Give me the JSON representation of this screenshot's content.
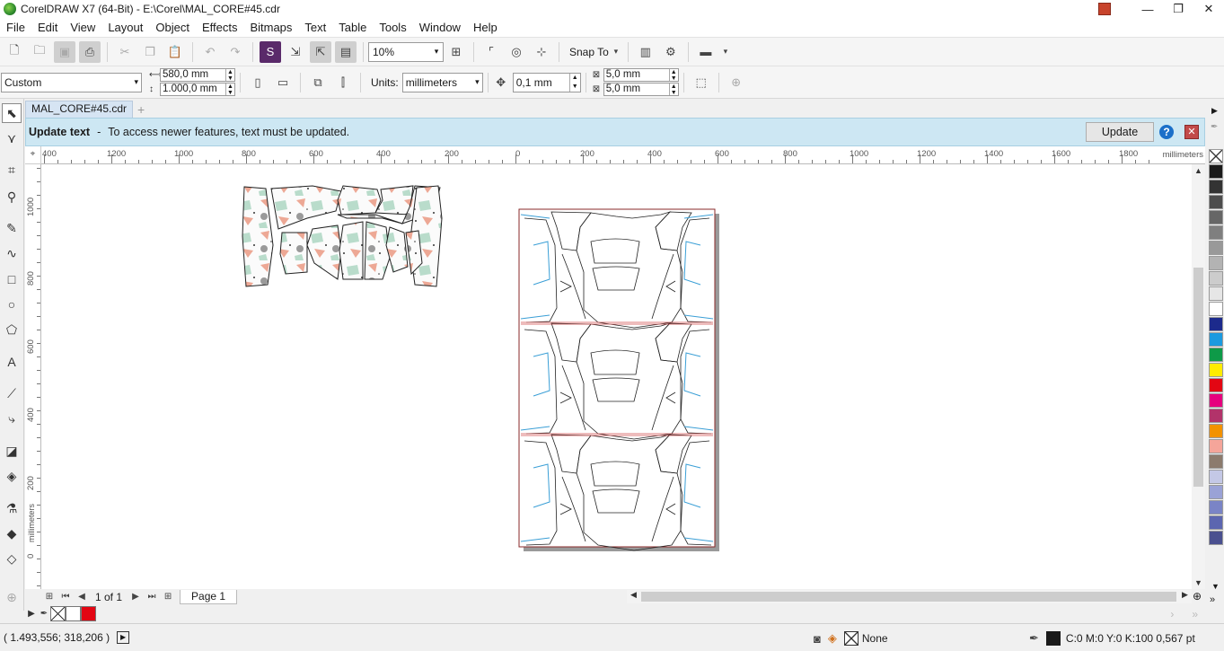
{
  "titlebar": {
    "title": "CorelDRAW X7 (64-Bit) - E:\\Corel\\MAL_CORE#45.cdr",
    "min": "—",
    "max": "❐",
    "close": "✕"
  },
  "menu": [
    "File",
    "Edit",
    "View",
    "Layout",
    "Object",
    "Effects",
    "Bitmaps",
    "Text",
    "Table",
    "Tools",
    "Window",
    "Help"
  ],
  "toolbar": {
    "zoom": "10%",
    "snap_to": "Snap To"
  },
  "propbar": {
    "preset": "Custom",
    "width": "580,0 mm",
    "height": "1.000,0 mm",
    "units_label": "Units:",
    "units": "millimeters",
    "nudge": "0,1 mm",
    "dup_x": "5,0 mm",
    "dup_y": "5,0 mm"
  },
  "doc_tab": {
    "name": "MAL_CORE#45.cdr",
    "add": "+"
  },
  "banner": {
    "title": "Update text",
    "dash": "-",
    "message": "To access newer features, text must be updated.",
    "update_button": "Update",
    "help": "?",
    "close": "✕"
  },
  "hruler": {
    "unit": "millimeters",
    "labels": [
      "400",
      "1200",
      "1000",
      "800",
      "600",
      "400",
      "200",
      "0",
      "200",
      "400",
      "600",
      "800",
      "1000",
      "1200",
      "1400",
      "1600",
      "1800"
    ]
  },
  "vruler": {
    "unit": "millimeters",
    "labels": [
      "1000",
      "800",
      "600",
      "400",
      "200",
      "0"
    ]
  },
  "pagenav": {
    "page_count": "1 of 1",
    "page_tab": "Page 1"
  },
  "status": {
    "coords": "( 1.493,556; 318,206 )",
    "fill": "None",
    "outline": "C:0 M:0 Y:0 K:100  0,567 pt"
  },
  "colors": {
    "accent": "#cde7f3",
    "cut_line": "#d14b4b",
    "seam_blue": "#3a9fd6",
    "pattern_pink": "#eda895",
    "pattern_mint": "#b9dccb",
    "pattern_gray": "#9a9a9a"
  },
  "palette": [
    "#ffffff",
    "#1a1a1a",
    "#333333",
    "#4d4d4d",
    "#666666",
    "#7f7f7f",
    "#999999",
    "#b3b3b3",
    "#cccccc",
    "#e6e6e6",
    "#ffffff",
    "#1c2a8c",
    "#1b9ae0",
    "#0e9a48",
    "#ffec00",
    "#e30613",
    "#e6007e",
    "#b2336a",
    "#f39200",
    "#f5a59a",
    "#8c7b6d",
    "#c4c8e6",
    "#9aa2d6",
    "#7a84c6",
    "#5c66b0",
    "#4a508f"
  ]
}
